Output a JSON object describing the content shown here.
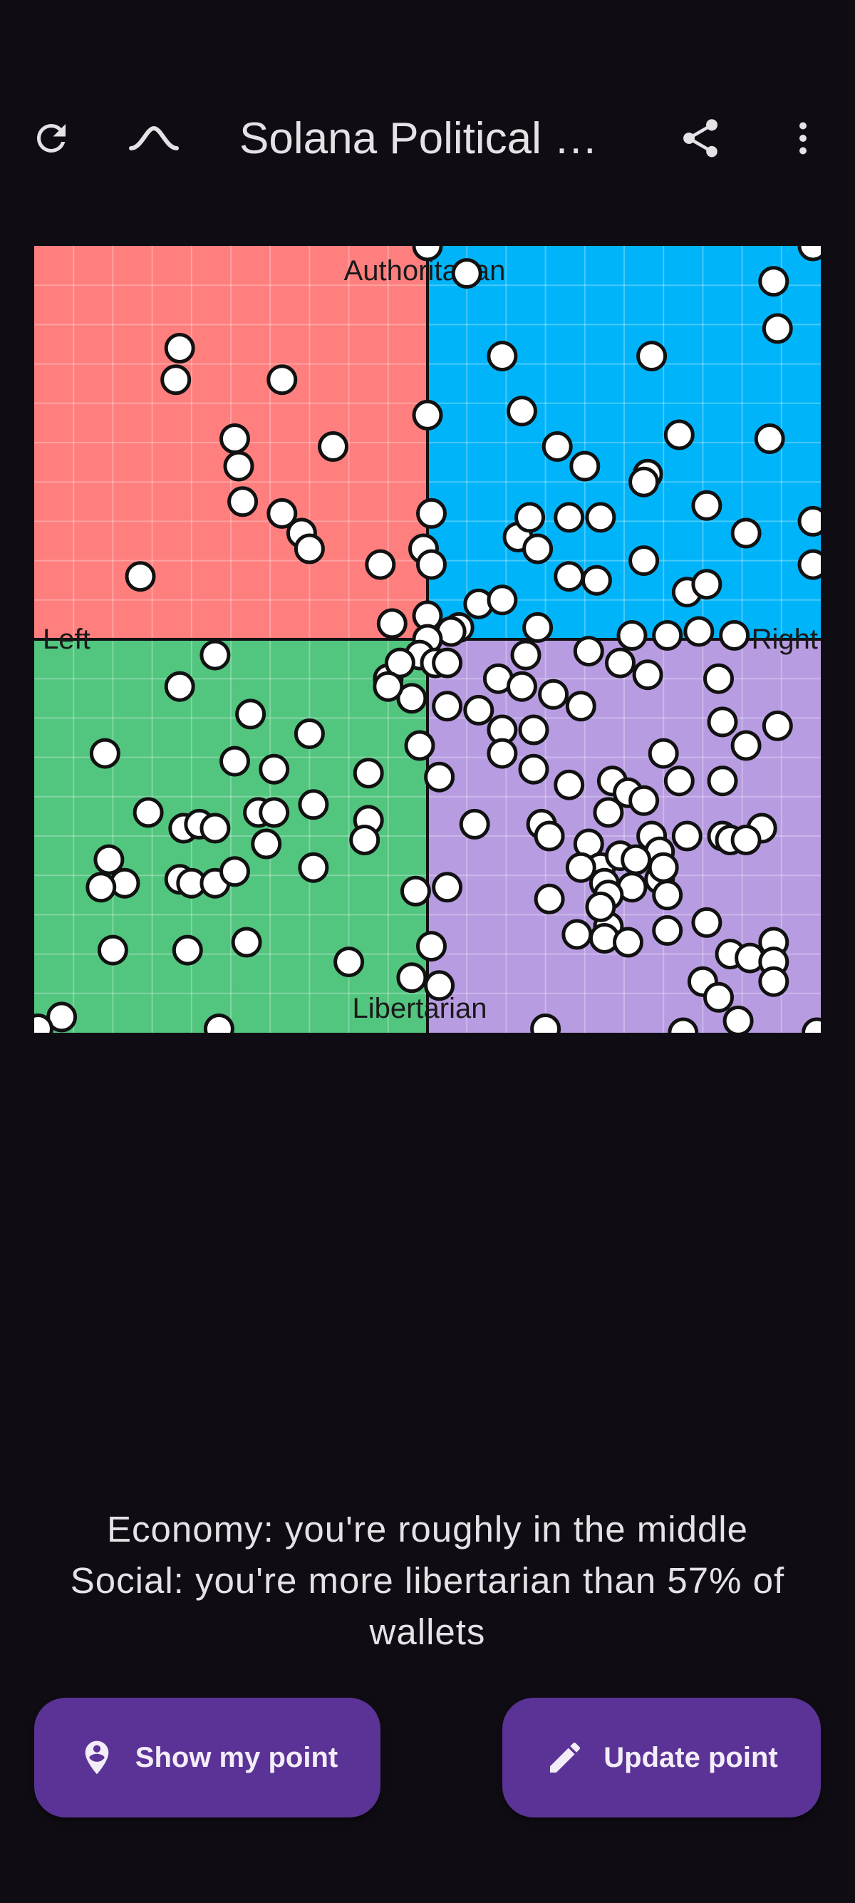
{
  "app_bar": {
    "title": "Solana Political …",
    "icons": [
      "refresh-icon",
      "collapse-chevron-icon",
      "share-icon",
      "more-vert-icon"
    ]
  },
  "chart_data": {
    "type": "scatter",
    "title": "",
    "xlim": [
      -10,
      10
    ],
    "ylim": [
      -10,
      10
    ],
    "grid": true,
    "quadrant_labels": {
      "top": "Authoritarian",
      "bottom": "Libertarian",
      "left": "Left",
      "right": "Right"
    },
    "quadrant_colors": {
      "authoritarian_left": "#ff7e7e",
      "authoritarian_right": "#00b4fa",
      "libertarian_left": "#52c57f",
      "libertarian_right": "#b89ce1"
    },
    "points": [
      [
        0,
        10
      ],
      [
        1,
        9.3
      ],
      [
        9.8,
        10
      ],
      [
        8.8,
        9.1
      ],
      [
        8.9,
        7.9
      ],
      [
        -6.3,
        7.4
      ],
      [
        -6.4,
        6.6
      ],
      [
        -3.7,
        6.6
      ],
      [
        -4.9,
        5.1
      ],
      [
        -2.4,
        4.9
      ],
      [
        -4.8,
        4.4
      ],
      [
        -4.7,
        3.5
      ],
      [
        -3.7,
        3.2
      ],
      [
        -3.2,
        2.7
      ],
      [
        -3,
        2.3
      ],
      [
        -7.3,
        1.6
      ],
      [
        -1.2,
        1.9
      ],
      [
        0,
        5.7
      ],
      [
        0.1,
        3.2
      ],
      [
        -0.1,
        2.3
      ],
      [
        0.1,
        1.9
      ],
      [
        1.9,
        7.2
      ],
      [
        2.4,
        5.8
      ],
      [
        3.3,
        4.9
      ],
      [
        4,
        4.4
      ],
      [
        5.7,
        7.2
      ],
      [
        6.4,
        5.2
      ],
      [
        5.6,
        4.2
      ],
      [
        5.5,
        4.0
      ],
      [
        8.7,
        5.1
      ],
      [
        7.1,
        3.4
      ],
      [
        8.1,
        2.7
      ],
      [
        9.8,
        3
      ],
      [
        9.8,
        1.9
      ],
      [
        2.3,
        2.6
      ],
      [
        2.6,
        3.1
      ],
      [
        2.8,
        2.3
      ],
      [
        3.6,
        3.1
      ],
      [
        4.4,
        3.1
      ],
      [
        3.6,
        1.6
      ],
      [
        4.3,
        1.5
      ],
      [
        5.5,
        2
      ],
      [
        6.6,
        1.2
      ],
      [
        7.1,
        1.4
      ],
      [
        1.3,
        0.9
      ],
      [
        1.9,
        1
      ],
      [
        2.8,
        0.3
      ],
      [
        4.1,
        -0.3
      ],
      [
        5.2,
        0.1
      ],
      [
        6.1,
        0.1
      ],
      [
        6.9,
        0.2
      ],
      [
        7.8,
        0.1
      ],
      [
        7.4,
        -1
      ],
      [
        5.6,
        -0.9
      ],
      [
        4.9,
        -0.6
      ],
      [
        2.5,
        -0.4
      ],
      [
        1.8,
        -1
      ],
      [
        2.4,
        -1.2
      ],
      [
        3.2,
        -1.4
      ],
      [
        3.9,
        -1.7
      ],
      [
        -0.9,
        0.4
      ],
      [
        0,
        0.6
      ],
      [
        0.8,
        0.3
      ],
      [
        0.6,
        0.2
      ],
      [
        0,
        0
      ],
      [
        -0.2,
        -0.4
      ],
      [
        0.2,
        -0.6
      ],
      [
        0.5,
        -0.6
      ],
      [
        -1,
        -1
      ],
      [
        -0.4,
        -1.5
      ],
      [
        0.5,
        -1.7
      ],
      [
        1.3,
        -1.8
      ],
      [
        1.9,
        -2.3
      ],
      [
        2.7,
        -2.3
      ],
      [
        1.9,
        -2.9
      ],
      [
        2.7,
        -3.3
      ],
      [
        0.3,
        -3.5
      ],
      [
        -0.2,
        -2.7
      ],
      [
        1.2,
        -4.7
      ],
      [
        2.9,
        -4.7
      ],
      [
        3.6,
        -3.7
      ],
      [
        4.7,
        -3.6
      ],
      [
        5.1,
        -3.9
      ],
      [
        5.5,
        -4.1
      ],
      [
        6.4,
        -3.6
      ],
      [
        4.6,
        -4.4
      ],
      [
        3.1,
        -5
      ],
      [
        4.1,
        -5.2
      ],
      [
        4.4,
        -5.8
      ],
      [
        5.7,
        -5
      ],
      [
        5.9,
        -5.4
      ],
      [
        6.6,
        -5
      ],
      [
        7.5,
        -5
      ],
      [
        7.7,
        -5.1
      ],
      [
        7.5,
        -2.1
      ],
      [
        6,
        -2.9
      ],
      [
        8.1,
        -2.7
      ],
      [
        8.9,
        -2.2
      ],
      [
        7.5,
        -3.6
      ],
      [
        8.5,
        -4.8
      ],
      [
        8.1,
        -5.1
      ],
      [
        5.9,
        -6.1
      ],
      [
        4.9,
        -5.5
      ],
      [
        5.3,
        -5.6
      ],
      [
        6,
        -5.8
      ],
      [
        5.2,
        -6.3
      ],
      [
        6.1,
        -6.5
      ],
      [
        4.5,
        -6.2
      ],
      [
        3.9,
        -5.8
      ],
      [
        4.6,
        -6.5
      ],
      [
        6.1,
        -7.4
      ],
      [
        4.6,
        -7.3
      ],
      [
        4.4,
        -6.8
      ],
      [
        3.1,
        -6.6
      ],
      [
        3.8,
        -7.5
      ],
      [
        4.5,
        -7.6
      ],
      [
        5.1,
        -7.7
      ],
      [
        7.7,
        -8
      ],
      [
        8.2,
        -8.1
      ],
      [
        8.8,
        -7.7
      ],
      [
        7.1,
        -7.2
      ],
      [
        8.8,
        -8.2
      ],
      [
        8.8,
        -8.7
      ],
      [
        7,
        -8.7
      ],
      [
        7.4,
        -9.1
      ],
      [
        7.9,
        -9.7
      ],
      [
        3,
        -9.9
      ],
      [
        6.5,
        -10
      ],
      [
        9.9,
        -10
      ],
      [
        -5.4,
        -0.4
      ],
      [
        -6.3,
        -1.2
      ],
      [
        -8.2,
        -2.9
      ],
      [
        -4.5,
        -1.9
      ],
      [
        -3.0,
        -2.4
      ],
      [
        -4.9,
        -3.1
      ],
      [
        -3.9,
        -3.3
      ],
      [
        -1.5,
        -3.4
      ],
      [
        -7.1,
        -4.4
      ],
      [
        -6.2,
        -4.8
      ],
      [
        -5.8,
        -4.7
      ],
      [
        -5.4,
        -4.8
      ],
      [
        -4.3,
        -4.4
      ],
      [
        -3.9,
        -4.4
      ],
      [
        -2.9,
        -4.2
      ],
      [
        -1.5,
        -4.6
      ],
      [
        -1.6,
        -5.1
      ],
      [
        -4.1,
        -5.2
      ],
      [
        -8.1,
        -5.6
      ],
      [
        -7.7,
        -6.2
      ],
      [
        -8.3,
        -6.3
      ],
      [
        -6.3,
        -6.1
      ],
      [
        -6.0,
        -6.2
      ],
      [
        -5.4,
        -6.2
      ],
      [
        -4.9,
        -5.9
      ],
      [
        -2.9,
        -5.8
      ],
      [
        -8,
        -7.9
      ],
      [
        -6.1,
        -7.9
      ],
      [
        -4.6,
        -7.7
      ],
      [
        -2,
        -8.2
      ],
      [
        -0.3,
        -6.4
      ],
      [
        0.5,
        -6.3
      ],
      [
        0.1,
        -7.8
      ],
      [
        -0.4,
        -8.6
      ],
      [
        0.3,
        -8.8
      ],
      [
        -9.3,
        -9.6
      ],
      [
        -9.9,
        -9.9
      ],
      [
        -5.3,
        -9.9
      ],
      [
        -0.7,
        -0.6
      ],
      [
        -1,
        -1.2
      ]
    ]
  },
  "result": {
    "line1": "Economy: you're roughly in the middle",
    "line2": "Social: you're more libertarian than 57% of wallets"
  },
  "buttons": {
    "show_my_point": "Show my point",
    "update_point": "Update point"
  }
}
